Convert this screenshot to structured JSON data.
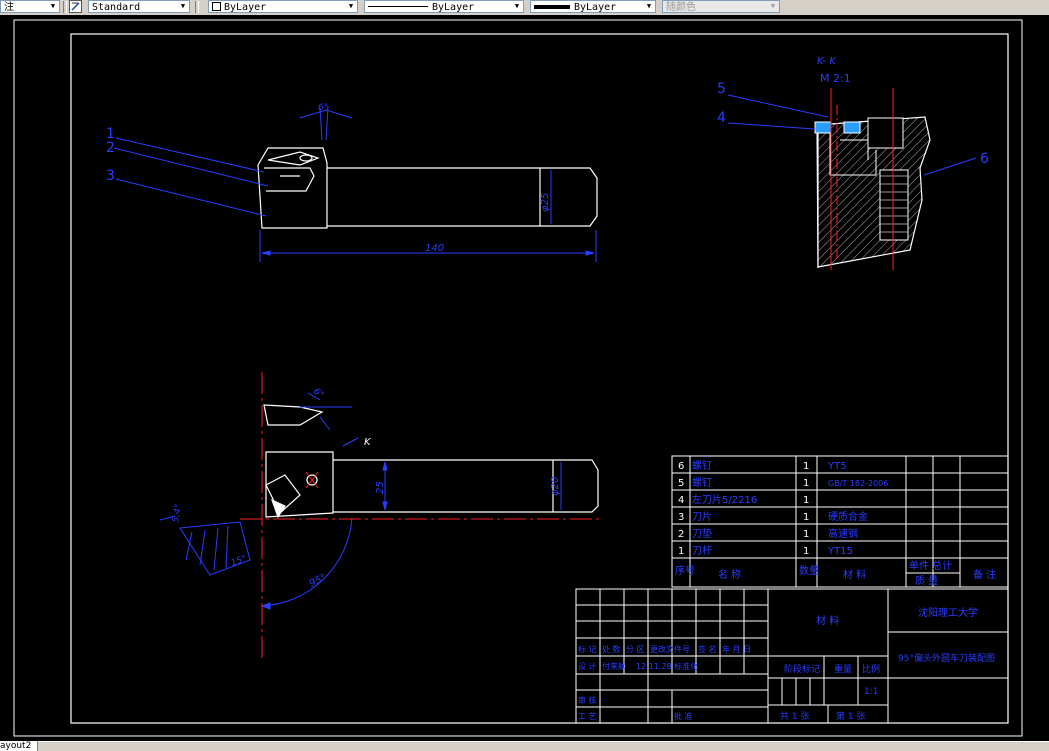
{
  "toolbar": {
    "annot_label": "注",
    "text_style": "Standard",
    "layer": "ByLayer",
    "linetype": "ByLayer",
    "lineweight": "ByLayer",
    "plot_style": "随颜色"
  },
  "status": {
    "layout_tab": "ayout2"
  },
  "views": {
    "section_title": "K- K",
    "section_scale": "M 2:1",
    "view_mark": "K"
  },
  "dims": {
    "length": "140",
    "dia_top": "φ25",
    "dia_bottom": "φ20",
    "height": "25",
    "angle_95": "95°",
    "angle_6a": "6°",
    "angle_6b": "6°",
    "angle_15": "15°",
    "angle_left": "5.4°"
  },
  "balloons": [
    "1",
    "2",
    "3",
    "4",
    "5",
    "6"
  ],
  "bom": {
    "rows": [
      {
        "no": "6",
        "name": "螺钉",
        "qty": "1",
        "material": "YT5",
        "note": ""
      },
      {
        "no": "5",
        "name": "螺钉",
        "qty": "1",
        "material": "GB/T 182-2006",
        "note": ""
      },
      {
        "no": "4",
        "name": "左刀片5/2216",
        "qty": "1",
        "material": "",
        "note": ""
      },
      {
        "no": "3",
        "name": "刀片",
        "qty": "1",
        "material": "硬质合金",
        "note": ""
      },
      {
        "no": "2",
        "name": "刀垫",
        "qty": "1",
        "material": "高速钢",
        "note": ""
      },
      {
        "no": "1",
        "name": "刀杆",
        "qty": "1",
        "material": "YT15",
        "note": ""
      }
    ],
    "header": {
      "no": "序号",
      "name": "名 称",
      "qty": "数量",
      "material": "材 料",
      "weight": "单件 总计",
      "weight2": "质 量",
      "note": "备 注"
    }
  },
  "title_block": {
    "material_label": "材 料",
    "university": "沈阳理工大学",
    "drawing_title": "95°偏头外圆车刀装配图",
    "rev_labels": [
      "标 记",
      "处 数",
      "分 区",
      "更改文件号",
      "签 名",
      "年 月 日"
    ],
    "design_row": [
      "设 计",
      "付来颖",
      "12.11.28",
      "标准化"
    ],
    "stage_label": "阶段标记",
    "weight_label": "重量",
    "scale_label": "比例",
    "scale_value": "1:1",
    "audit_label": "审 核",
    "craft_label": "工 艺",
    "approve_label": "批 准",
    "sheets_total": "共 1 张",
    "sheet_no": "第 1 张"
  }
}
